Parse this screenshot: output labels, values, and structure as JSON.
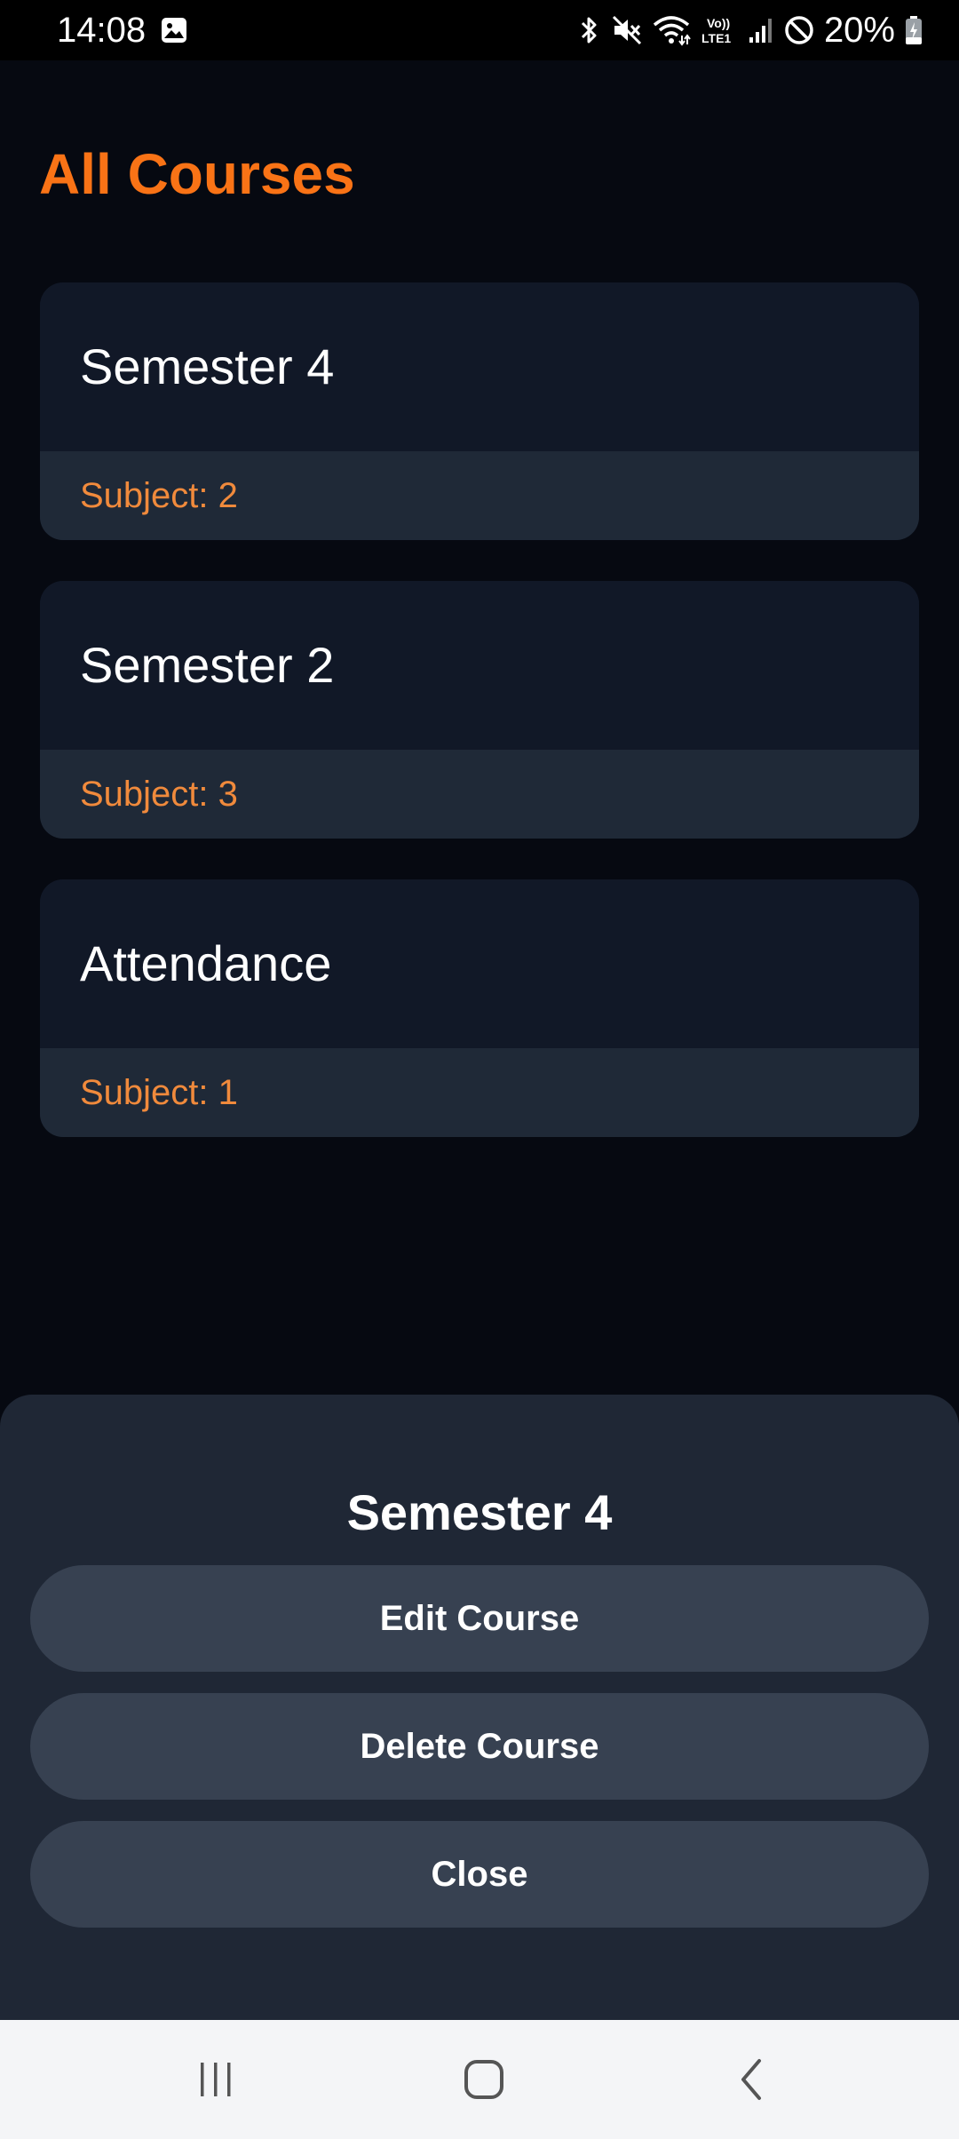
{
  "status_bar": {
    "time": "14:08",
    "battery": "20%",
    "icons": [
      "gallery-icon",
      "bluetooth-icon",
      "mute-icon",
      "wifi-icon",
      "volte-lte-icon",
      "signal-icon",
      "do-not-disturb-icon",
      "battery-charging-icon"
    ]
  },
  "header": {
    "title": "All Courses"
  },
  "courses": [
    {
      "name": "Semester 4",
      "subject": "Subject: 2"
    },
    {
      "name": "Semester 2",
      "subject": "Subject: 3"
    },
    {
      "name": "Attendance",
      "subject": "Subject: 1"
    }
  ],
  "bottom_sheet": {
    "title": "Semester 4",
    "edit_label": "Edit Course",
    "delete_label": "Delete Course",
    "close_label": "Close"
  },
  "nav_bar": {
    "icons": [
      "recents-icon",
      "home-icon",
      "back-icon"
    ]
  },
  "colors": {
    "accent": "#f97316",
    "background": "#060911",
    "card_top": "#111827",
    "card_bottom": "#1f2937",
    "sheet": "#1f2735",
    "sheet_button": "#374151"
  }
}
